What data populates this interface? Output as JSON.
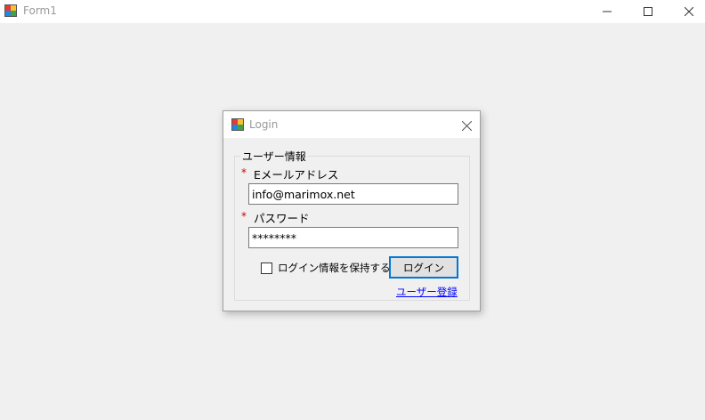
{
  "main_window": {
    "title": "Form1",
    "icon": "winforms-app-icon",
    "controls": [
      "minimize-icon",
      "maximize-icon",
      "close-icon"
    ]
  },
  "login_dialog": {
    "title": "Login",
    "icon": "winforms-app-icon",
    "group": {
      "legend": "ユーザー情報",
      "email": {
        "required_mark": "*",
        "label": "Eメールアドレス",
        "value": "info@marimox.net"
      },
      "password": {
        "required_mark": "*",
        "label": "パスワード",
        "value": "********"
      },
      "remember": {
        "label": "ログイン情報を保持する",
        "checked": false
      },
      "login_button": "ログイン",
      "register_link": "ユーザー登録"
    }
  },
  "colors": {
    "required": "#cc0000",
    "focus_border": "#0078d7",
    "link": "#0000ff"
  }
}
